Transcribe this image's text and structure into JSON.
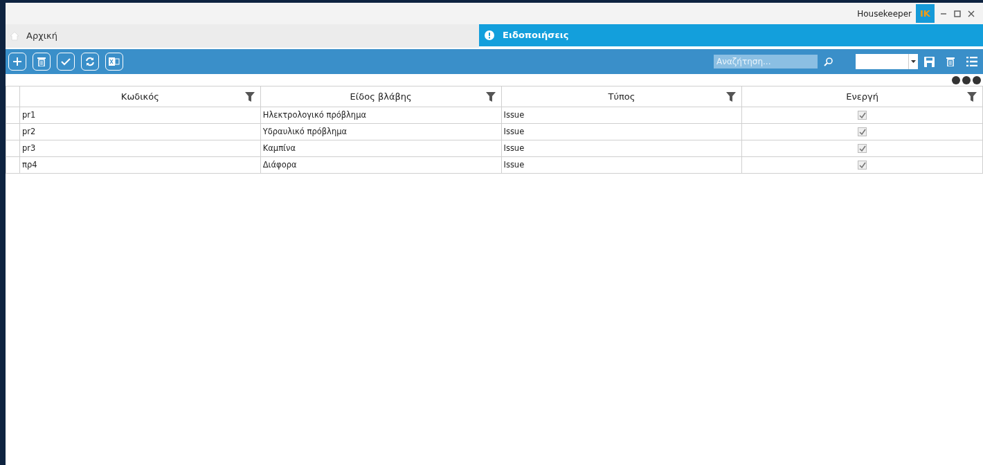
{
  "window": {
    "app_name": "Housekeeper",
    "logo": "IK"
  },
  "home_tab": {
    "label": "Αρχική"
  },
  "notifications": {
    "label": "Ειδοποιήσεις"
  },
  "toolbar": {
    "search": {
      "placeholder": "Αναζήτηση..."
    }
  },
  "table": {
    "columns": [
      "Κωδικός",
      "Είδος βλάβης",
      "Τύπος",
      "Ενεργή"
    ],
    "rows": [
      {
        "code": "pr1",
        "fault_type": "Ηλεκτρολογικό πρόβλημα",
        "type": "Issue",
        "active": true
      },
      {
        "code": "pr2",
        "fault_type": "Υδραυλικό πρόβλημα",
        "type": "Issue",
        "active": true
      },
      {
        "code": "pr3",
        "fault_type": "Καμπίνα",
        "type": "Issue",
        "active": true
      },
      {
        "code": "πρ4",
        "fault_type": "Διάφορα",
        "type": "Issue",
        "active": true
      }
    ]
  }
}
